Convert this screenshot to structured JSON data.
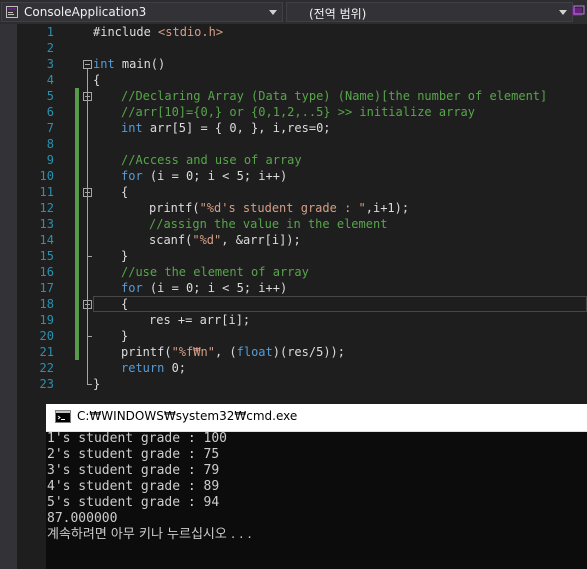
{
  "navbar": {
    "project_name": "ConsoleApplication3",
    "scope_name": "(전역 범위)"
  },
  "editor": {
    "line_numbers": [
      "1",
      "2",
      "3",
      "4",
      "5",
      "6",
      "7",
      "8",
      "9",
      "10",
      "11",
      "12",
      "13",
      "14",
      "15",
      "16",
      "17",
      "18",
      "19",
      "20",
      "21",
      "22",
      "23"
    ],
    "code": {
      "l1_include": "#include ",
      "l1_header": "<stdio.h>",
      "l3_int": "int",
      "l3_rest": " main()",
      "l4": "{",
      "l5": "//Declaring Array (Data type) (Name)[the number of element]",
      "l6": "//arr[10]={0,} or {0,1,2,..5} >> initialize array",
      "l7_int": "int",
      "l7_rest": " arr[5] = { 0, }, i,res=0;",
      "l9": "//Access and use of array",
      "l10_for": "for",
      "l10_rest": " (i = 0; i < 5; i++)",
      "l11": "{",
      "l12_a": "printf(",
      "l12_str": "\"%d's student grade : \"",
      "l12_b": ",i+1);",
      "l13": "//assign the value in the element",
      "l14_a": "scanf(",
      "l14_str": "\"%d\"",
      "l14_b": ", &arr[i]);",
      "l15": "}",
      "l16": "//use the element of array",
      "l17_for": "for",
      "l17_rest": " (i = 0; i < 5; i++)",
      "l18": "{",
      "l19": "res += arr[i];",
      "l20": "}",
      "l21_a": "printf(",
      "l21_str": "\"%f₩n\"",
      "l21_b": ", (",
      "l21_float": "float",
      "l21_c": ")(res/5));",
      "l22_return": "return",
      "l22_rest": " 0;",
      "l23": "}"
    }
  },
  "console": {
    "title": "C:₩WINDOWS₩system32₩cmd.exe",
    "lines": [
      "1's student grade : 100",
      "2's student grade : 75",
      "3's student grade : 79",
      "4's student grade : 89",
      "5's student grade : 94",
      "87.000000",
      "계속하려면 아무 키나 누르십시오 . . ."
    ]
  },
  "colors": {
    "keyword": "#569cd6",
    "comment": "#57a64a",
    "string": "#d69d85",
    "line_number": "#2b91af",
    "change_bar": "#579b4a"
  },
  "icons": [
    "project-icon",
    "scope-icon",
    "dropdown-caret-icon",
    "console-app-icon",
    "collapse-icon"
  ]
}
